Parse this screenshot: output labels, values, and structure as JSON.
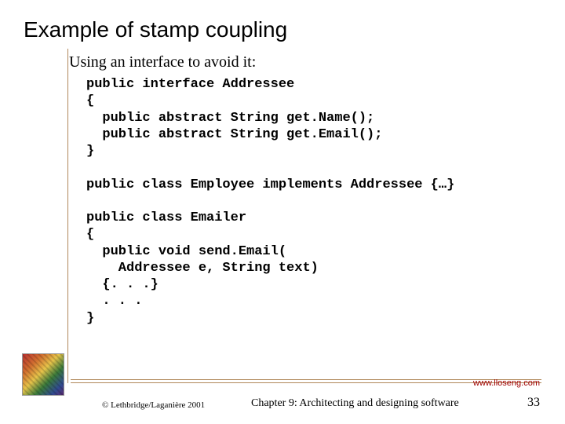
{
  "title": "Example of stamp coupling",
  "subtitle": "Using an interface to avoid it:",
  "code": "public interface Addressee\n{\n  public abstract String get.Name();\n  public abstract String get.Email();\n}\n\npublic class Employee implements Addressee {…}\n\npublic class Emailer\n{\n  public void send.Email(\n    Addressee e, String text)\n  {. . .}\n  . . .\n}",
  "url": "www.lloseng.com",
  "copyright": "© Lethbridge/Laganière 2001",
  "chapter": "Chapter 9: Architecting and designing software",
  "pagenum": "33"
}
